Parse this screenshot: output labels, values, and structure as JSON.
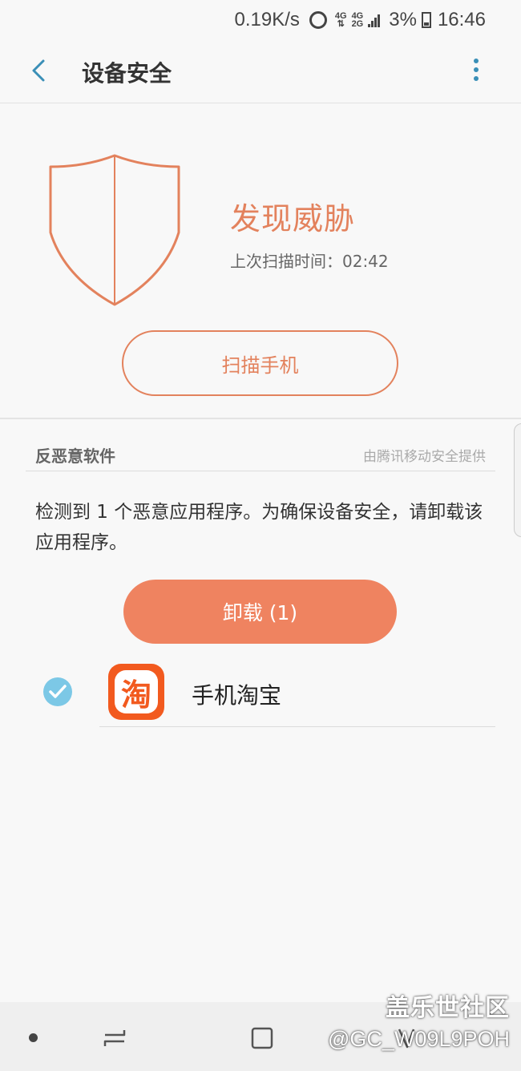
{
  "status_bar": {
    "net_speed": "0.19K/s",
    "sim1_type": "4G",
    "sim2_type": "4G",
    "sim2_sub": "2G",
    "battery_percent": "3%",
    "time": "16:46"
  },
  "app_bar": {
    "title": "设备安全"
  },
  "scan_status": {
    "title": "发现威胁",
    "last_scan": "上次扫描时间：02:42",
    "scan_button": "扫描手机",
    "accent_color": "#e3825d"
  },
  "malware_section": {
    "header": "反恶意软件",
    "provider": "由腾讯移动安全提供",
    "description": "检测到 1 个恶意应用程序。为确保设备安全，请卸载该应用程序。",
    "uninstall_button": "卸载 (1)",
    "apps": [
      {
        "name": "手机淘宝",
        "icon_glyph": "淘",
        "checked": true,
        "icon": "taobao-icon"
      }
    ]
  },
  "nav_bar": {
    "items": [
      "dot",
      "recent-apps-icon",
      "home-icon",
      "back-icon"
    ]
  },
  "watermark": {
    "title": "盖乐世社区",
    "user": "@GC_W09L9POH"
  }
}
